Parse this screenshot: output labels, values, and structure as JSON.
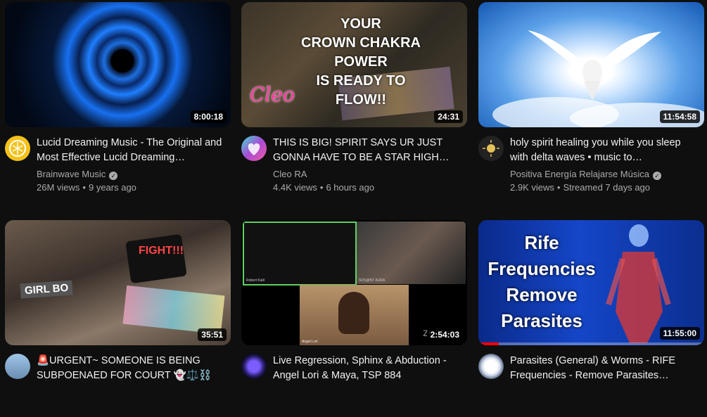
{
  "videos": [
    {
      "title": "Lucid Dreaming Music - The Original and Most Effective Lucid Dreaming…",
      "channel": "Brainwave Music",
      "verified": true,
      "views": "26M views",
      "age": "9 years ago",
      "duration": "8:00:18"
    },
    {
      "title": "THIS IS BIG! SPIRIT SAYS UR JUST GONNA HAVE TO BE A STAR HIGH…",
      "channel": "Cleo RA",
      "verified": false,
      "views": "4.4K views",
      "age": "6 hours ago",
      "duration": "24:31",
      "thumb_text": [
        "YOUR",
        "CROWN CHAKRA",
        "POWER",
        "IS READY TO",
        "FLOW!!"
      ],
      "thumb_logo": "Cleo RA"
    },
    {
      "title": "holy spirit healing you while you sleep with delta waves • music to…",
      "channel": "Positiva Energía Relajarse Música",
      "verified": true,
      "views": "2.9K views",
      "age": "Streamed 7 days ago",
      "duration": "11:54:58"
    },
    {
      "title": "🚨URGENT~ SOMEONE IS BEING SUBPOENAED FOR COURT 👻⚖️⛓️",
      "duration": "35:51",
      "thumb_text": [
        "FIGHT!!!",
        "GIRL BO"
      ]
    },
    {
      "title": "Live Regression, Sphinx & Abduction - Angel Lori & Maya, TSP 884",
      "duration": "2:54:03",
      "thumb_text": [
        "Robert Kalil",
        "SOS@NT AURA",
        "Angel Lori",
        "zoom"
      ]
    },
    {
      "title": "Parasites (General) & Worms - RIFE Frequencies - Remove Parasites…",
      "duration": "11:55:00",
      "thumb_text": [
        "Rife",
        "Frequencies",
        "Remove",
        "Parasites"
      ],
      "progress": 0.09
    }
  ],
  "colors": {
    "background": "#0f0f0f",
    "text_primary": "#f1f1f1",
    "text_secondary": "#aaaaaa",
    "progress": "#ff0000"
  }
}
